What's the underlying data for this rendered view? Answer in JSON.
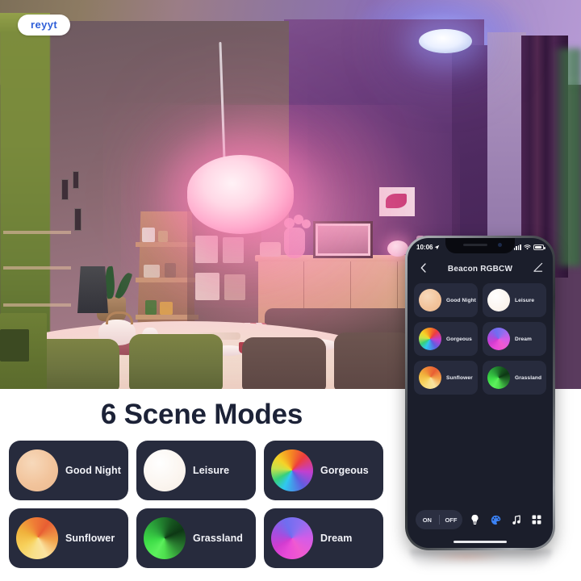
{
  "brand": {
    "logo_text": "reyyt"
  },
  "headline": {
    "title": "6 Scene Modes"
  },
  "scene_modes": [
    {
      "name": "Good Night",
      "swatch": "sw-goodnight",
      "swatch_color": "#f2c49c"
    },
    {
      "name": "Leisure",
      "swatch": "sw-leisure",
      "swatch_color": "#fbf5ef"
    },
    {
      "name": "Gorgeous",
      "swatch": "sw-gorgeous",
      "swatch_color": "#f5d328"
    },
    {
      "name": "Sunflower",
      "swatch": "sw-sunflower",
      "swatch_color": "#f0b23c"
    },
    {
      "name": "Grassland",
      "swatch": "sw-grassland",
      "swatch_color": "#2aa03a"
    },
    {
      "name": "Dream",
      "swatch": "sw-dream",
      "swatch_color": "#d35ce8"
    }
  ],
  "phone": {
    "status_bar": {
      "time": "10:06",
      "location_icon": "location-arrow-icon",
      "signal_icon": "signal-bars-icon",
      "wifi_icon": "wifi-icon",
      "battery_icon": "battery-icon"
    },
    "nav": {
      "back_icon": "chevron-left-icon",
      "title": "Beacon RGBCW",
      "edit_icon": "pencil-edit-icon"
    },
    "scene_modes": [
      {
        "name": "Good Night",
        "swatch": "sw-goodnight"
      },
      {
        "name": "Leisure",
        "swatch": "sw-leisure"
      },
      {
        "name": "Gorgeous",
        "swatch": "sw-gorgeous"
      },
      {
        "name": "Dream",
        "swatch": "sw-dream"
      },
      {
        "name": "Sunflower",
        "swatch": "sw-sunflower"
      },
      {
        "name": "Grassland",
        "swatch": "sw-grassland"
      }
    ],
    "toolbar": {
      "on_label": "ON",
      "off_label": "OFF",
      "icons": [
        {
          "name": "bulb-icon",
          "glyph": "●",
          "active": false
        },
        {
          "name": "palette-icon",
          "glyph": "●",
          "active": true
        },
        {
          "name": "music-note-icon",
          "glyph": "♫",
          "active": false
        },
        {
          "name": "grid-apps-icon",
          "glyph": "▦",
          "active": false
        }
      ]
    }
  },
  "colors": {
    "card_bg": "#272b3d",
    "panel_bg": "#ffffff",
    "title_color": "#1c2237",
    "accent_blue": "#3b82f6",
    "logo_blue": "#2f5fd8"
  },
  "photo": {
    "description_alt": "living-room-with-smart-rgb-lighting",
    "fixtures": [
      "pendant-lamp-pink",
      "ceiling-light-blue"
    ]
  }
}
